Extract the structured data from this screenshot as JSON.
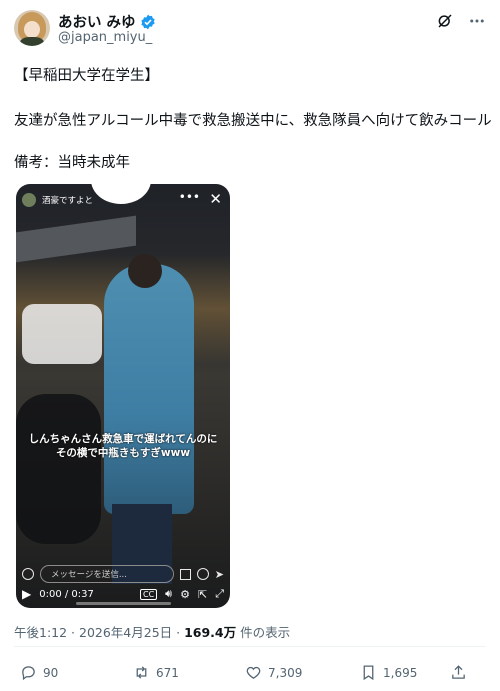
{
  "author": {
    "display_name": "あおい みゆ",
    "handle": "@japan_miyu_"
  },
  "post": {
    "line1": "【早稲田大学在学生】",
    "line2": "友達が急性アルコール中毒で救急搬送中に、救急隊員へ向けて飲みコール",
    "line3": "備考：当時未成年"
  },
  "video": {
    "uploader": "酒豪ですよと",
    "caption_line1": "しんちゃんさん救急車で運ばれてんのに",
    "caption_line2": "その横で中瓶きもすぎwww",
    "message_placeholder": "メッセージを送信...",
    "time": "0:00 / 0:37",
    "cc_label": "CC",
    "progress": 0
  },
  "meta": {
    "time": "午後1:12",
    "date": "2026年4月25日",
    "views": "169.4万",
    "views_suffix": "件の表示"
  },
  "actions": {
    "replies": "90",
    "reposts": "671",
    "likes": "7,309",
    "bookmarks": "1,695"
  },
  "colors": {
    "accent": "#1d9bf0",
    "text": "#0f1419",
    "secondary": "#536471"
  },
  "icons": [
    "verified-badge-icon",
    "grok-icon",
    "more-icon",
    "reply-icon",
    "repost-icon",
    "like-icon",
    "bookmark-icon"
  ]
}
